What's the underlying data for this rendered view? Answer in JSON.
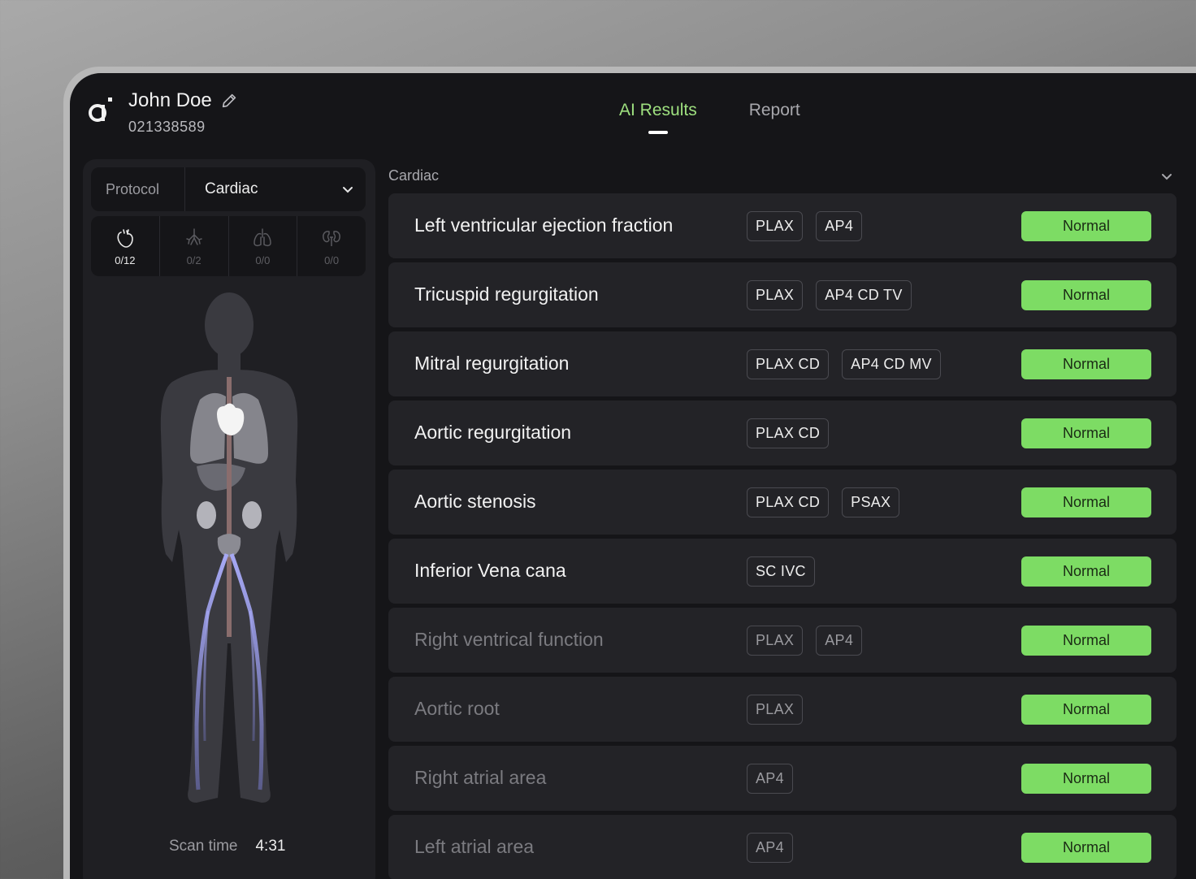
{
  "patient": {
    "name": "John Doe",
    "id": "021338589"
  },
  "tabs": [
    {
      "label": "AI Results",
      "active": true
    },
    {
      "label": "Report",
      "active": false
    }
  ],
  "protocol": {
    "label": "Protocol",
    "value": "Cardiac"
  },
  "organs": [
    {
      "icon": "heart-icon",
      "count": "0/12",
      "active": true
    },
    {
      "icon": "lungs-bronchi-icon",
      "count": "0/2",
      "active": false
    },
    {
      "icon": "lungs-icon",
      "count": "0/0",
      "active": false
    },
    {
      "icon": "kidneys-icon",
      "count": "0/0",
      "active": false
    }
  ],
  "scan": {
    "label": "Scan time",
    "value": "4:31"
  },
  "section": {
    "title": "Cardiac"
  },
  "results": [
    {
      "name": "Left ventricular ejection fraction",
      "tags": [
        "PLAX",
        "AP4"
      ],
      "status": "Normal",
      "dim": false
    },
    {
      "name": "Tricuspid regurgitation",
      "tags": [
        "PLAX",
        "AP4 CD TV"
      ],
      "status": "Normal",
      "dim": false
    },
    {
      "name": "Mitral regurgitation",
      "tags": [
        "PLAX CD",
        "AP4 CD MV"
      ],
      "status": "Normal",
      "dim": false
    },
    {
      "name": "Aortic regurgitation",
      "tags": [
        "PLAX CD"
      ],
      "status": "Normal",
      "dim": false
    },
    {
      "name": "Aortic stenosis",
      "tags": [
        "PLAX CD",
        "PSAX"
      ],
      "status": "Normal",
      "dim": false
    },
    {
      "name": "Inferior Vena cana",
      "tags": [
        "SC IVC"
      ],
      "status": "Normal",
      "dim": false
    },
    {
      "name": "Right ventrical function",
      "tags": [
        "PLAX",
        "AP4"
      ],
      "status": "Normal",
      "dim": true
    },
    {
      "name": "Aortic root",
      "tags": [
        "PLAX"
      ],
      "status": "Normal",
      "dim": true
    },
    {
      "name": "Right atrial area",
      "tags": [
        "AP4"
      ],
      "status": "Normal",
      "dim": true
    },
    {
      "name": "Left atrial area",
      "tags": [
        "AP4"
      ],
      "status": "Normal",
      "dim": true
    }
  ],
  "colors": {
    "accent": "#9ee07f",
    "status_normal": "#7ddc64",
    "background": "#151518"
  }
}
